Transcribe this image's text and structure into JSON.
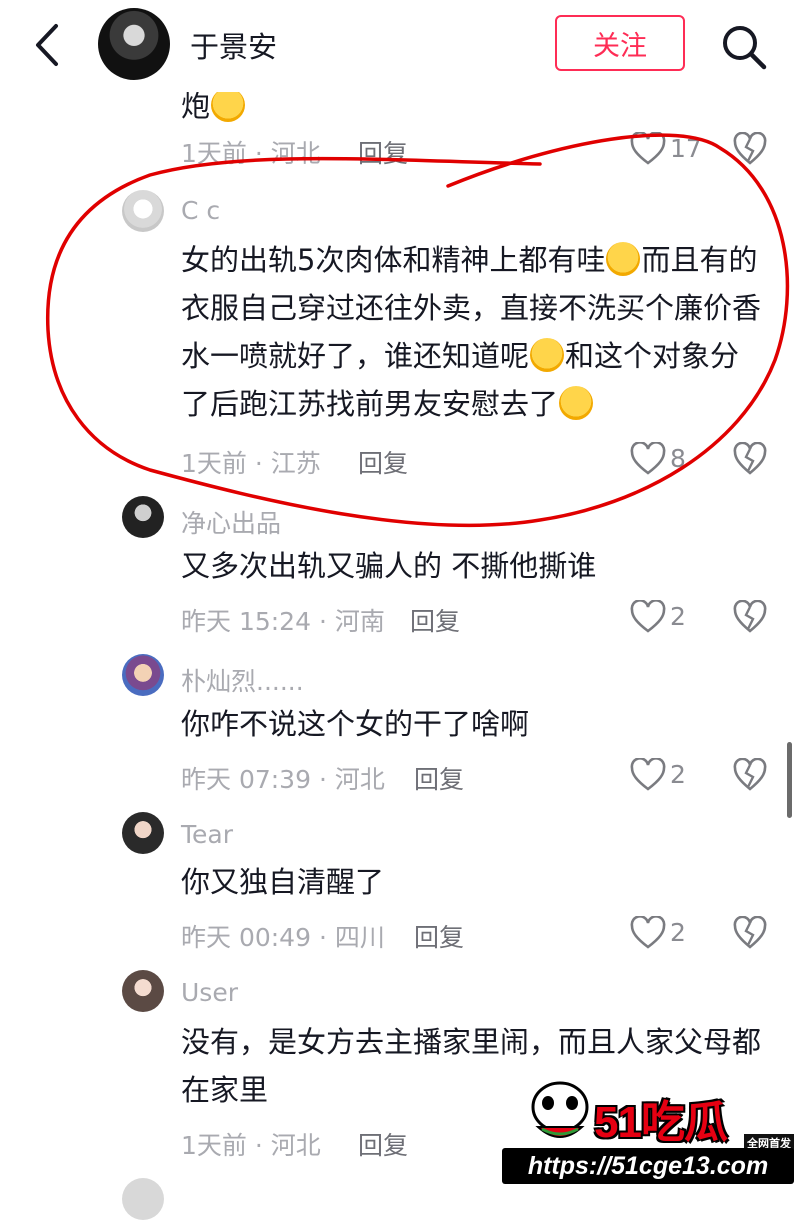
{
  "header": {
    "back_icon": "back-chevron-icon",
    "username": "于景安",
    "follow_label": "关注",
    "search_icon": "search-icon",
    "accent_color": "#fe2c55"
  },
  "comments": [
    {
      "text": "炮",
      "time": "1天前",
      "location": "河北",
      "reply_label": "回复",
      "likes": "17"
    },
    {
      "username": "C c",
      "text_parts": [
        "女的出轨5次肉体和精神上都有哇",
        "而且有的衣服自己穿过还往外卖，直接不洗买个廉价香水一喷就好了，谁还知道呢",
        "和这个对象分了后跑江苏找前男友安慰去了"
      ],
      "time": "1天前",
      "location": "江苏",
      "reply_label": "回复",
      "likes": "8"
    },
    {
      "username": "净心出品",
      "text": "又多次出轨又骗人的 不撕他撕谁",
      "time": "昨天 15:24",
      "location": "河南",
      "reply_label": "回复",
      "likes": "2"
    },
    {
      "username": "朴灿烈......",
      "text": "你咋不说这个女的干了啥啊",
      "time": "昨天 07:39",
      "location": "河北",
      "reply_label": "回复",
      "likes": "2"
    },
    {
      "username": "Tear",
      "text": "你又独自清醒了",
      "time": "昨天 00:49",
      "location": "四川",
      "reply_label": "回复",
      "likes": "2"
    },
    {
      "username": "User",
      "text": "没有，是女方去主播家里闹，而且人家父母都在家里",
      "time": "1天前",
      "location": "河北",
      "reply_label": "回复"
    }
  ],
  "icons": {
    "like": "heart-outline-icon",
    "dislike": "broken-heart-icon"
  },
  "watermark": {
    "logo_text": "51吃瓜",
    "badge": "全网首发",
    "url": "https://51cge13.com"
  }
}
